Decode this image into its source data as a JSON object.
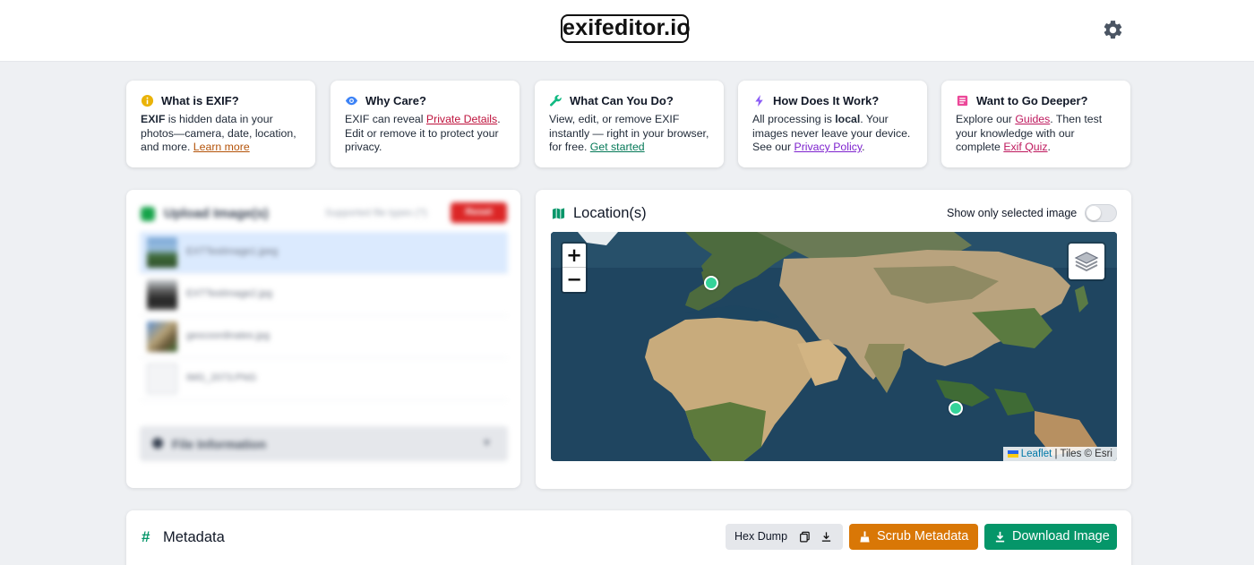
{
  "header": {
    "logo": "exifeditor.io",
    "settings_icon": "gear-icon"
  },
  "info_cards": [
    {
      "icon": "info-icon",
      "icon_color": "#eab308",
      "title": "What is EXIF?",
      "body_bold": "EXIF",
      "body_pre": " is hidden data in your photos—camera, date, location, and more. ",
      "link": "Learn more",
      "body_post": ""
    },
    {
      "icon": "eye-icon",
      "icon_color": "#3b82f6",
      "title": "Why Care?",
      "body_pre": "EXIF can reveal ",
      "link": "Private Details",
      "body_post": ". Edit or remove it to protect your privacy."
    },
    {
      "icon": "wrench-icon",
      "icon_color": "#10b981",
      "title": "What Can You Do?",
      "body_pre": "View, edit, or remove EXIF instantly — right in your browser, for free. ",
      "link": "Get started",
      "body_post": ""
    },
    {
      "icon": "lightning-icon",
      "icon_color": "#8b5cf6",
      "title": "How Does It Work?",
      "body_pre": "All processing is ",
      "body_bold": "local",
      "body_mid": ". Your images never leave your device. See our ",
      "link": "Privacy Policy",
      "body_post": "."
    },
    {
      "icon": "book-icon",
      "icon_color": "#ec4899",
      "title": "Want to Go Deeper?",
      "body_pre": "Explore our ",
      "link": "Guides",
      "body_mid": ". Then test your knowledge with our complete ",
      "link2": "Exif Quiz",
      "body_post": "."
    }
  ],
  "upload": {
    "title": "Upload Image(s)",
    "supported": "Supported file types (?)",
    "reset_label": "Reset",
    "files": [
      {
        "name": "EXTTestImage1.jpeg",
        "selected": true
      },
      {
        "name": "EXTTestImage2.jpg",
        "selected": false
      },
      {
        "name": "geocoordinates.jpg",
        "selected": false
      },
      {
        "name": "IMG_2073.PNG",
        "selected": false
      }
    ],
    "file_info_label": "File Information"
  },
  "location": {
    "title": "Location(s)",
    "toggle_label": "Show only selected image",
    "toggle_on": false,
    "zoom_in": "+",
    "zoom_out": "−",
    "attribution_leaflet": "Leaflet",
    "attribution_tiles": " | Tiles © Esri"
  },
  "metadata": {
    "hash": "#",
    "title": "Metadata",
    "hex_dump_label": "Hex Dump",
    "scrub_label": "Scrub Metadata",
    "download_label": "Download Image"
  }
}
